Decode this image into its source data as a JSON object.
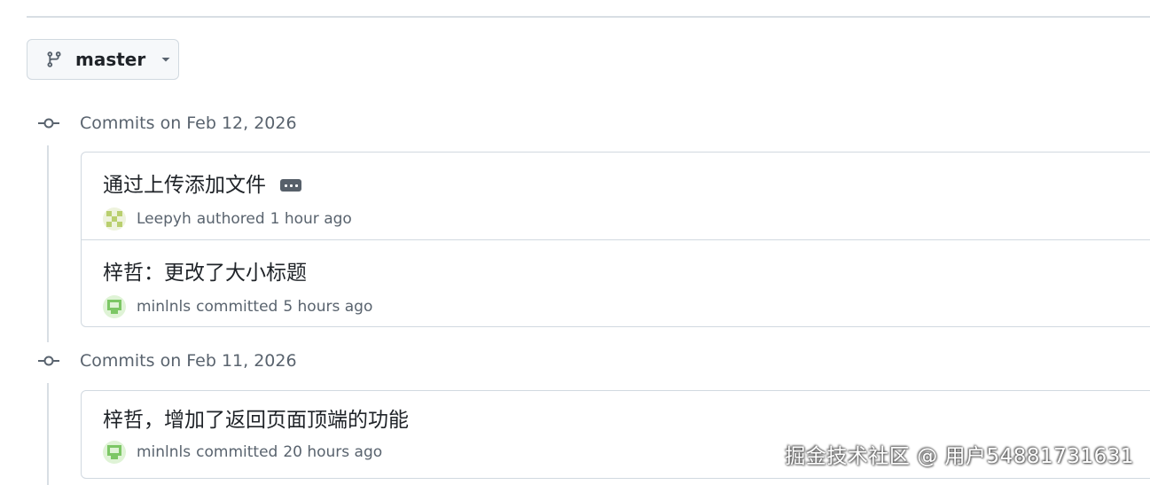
{
  "branch": {
    "name": "master",
    "icon": "git-branch-icon"
  },
  "commit_groups": [
    {
      "title": "Commits on Feb 12, 2026",
      "commits": [
        {
          "message": "通过上传添加文件",
          "has_ellipsis": true,
          "author": "Leepyh",
          "action": "authored",
          "time": "1 hour ago",
          "avatar_color": "#c8d98a"
        },
        {
          "message": "梓哲：更改了大小标题",
          "has_ellipsis": false,
          "author": "minlnls",
          "action": "committed",
          "time": "5 hours ago",
          "avatar_color": "#8ed07a"
        }
      ]
    },
    {
      "title": "Commits on Feb 11, 2026",
      "commits": [
        {
          "message": "梓哲，增加了返回页面顶端的功能",
          "has_ellipsis": false,
          "author": "minlnls",
          "action": "committed",
          "time": "20 hours ago",
          "avatar_color": "#8ed07a"
        }
      ]
    }
  ],
  "watermark": "掘金技术社区 @ 用户54881731631"
}
